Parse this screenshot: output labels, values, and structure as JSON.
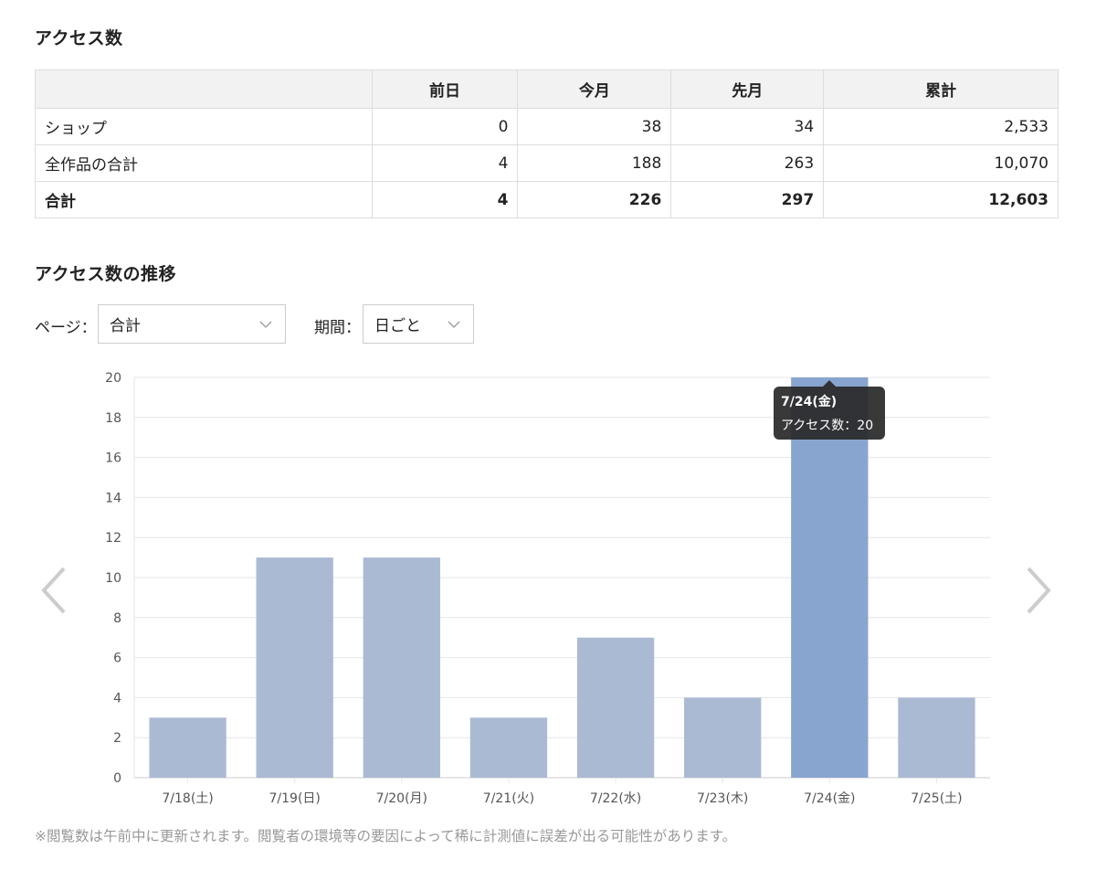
{
  "sections": {
    "access_title": "アクセス数",
    "trend_title": "アクセス数の推移"
  },
  "table": {
    "headers": [
      "",
      "前日",
      "今月",
      "先月",
      "累計"
    ],
    "rows": [
      {
        "label": "ショップ",
        "values": [
          "0",
          "38",
          "34",
          "2,533"
        ]
      },
      {
        "label": "全作品の合計",
        "values": [
          "4",
          "188",
          "263",
          "10,070"
        ]
      },
      {
        "label": "合計",
        "values": [
          "4",
          "226",
          "297",
          "12,603"
        ]
      }
    ]
  },
  "filters": {
    "page_label": "ページ：",
    "page_value": "合計",
    "period_label": "期間：",
    "period_value": "日ごと"
  },
  "tooltip": {
    "date": "7/24(金)",
    "text": "アクセス数：20"
  },
  "footnote": "※閲覧数は午前中に更新されます。閲覧者の環境等の要因によって稀に計測値に誤差が出る可能性があります。",
  "icons": {
    "prev": "chevron-left-icon",
    "next": "chevron-right-icon",
    "dropdown": "chevron-down-icon"
  },
  "colors": {
    "bar": "#aabad3",
    "bar_highlight": "#88a5cf",
    "grid": "#e6e6e6",
    "tick_text": "#555555",
    "arrow": "#cccccc"
  },
  "chart_data": {
    "type": "bar",
    "categories": [
      "7/18(土)",
      "7/19(日)",
      "7/20(月)",
      "7/21(火)",
      "7/22(水)",
      "7/23(木)",
      "7/24(金)",
      "7/25(土)"
    ],
    "series": [
      {
        "values": [
          3,
          11,
          11,
          3,
          7,
          4,
          20,
          4
        ]
      }
    ],
    "ylim": [
      0,
      20
    ],
    "yticks": [
      0,
      2,
      4,
      6,
      8,
      10,
      12,
      14,
      16,
      18,
      20
    ],
    "highlighted_category": "7/24(金)",
    "grid": true,
    "title": "",
    "xlabel": "",
    "ylabel": ""
  }
}
